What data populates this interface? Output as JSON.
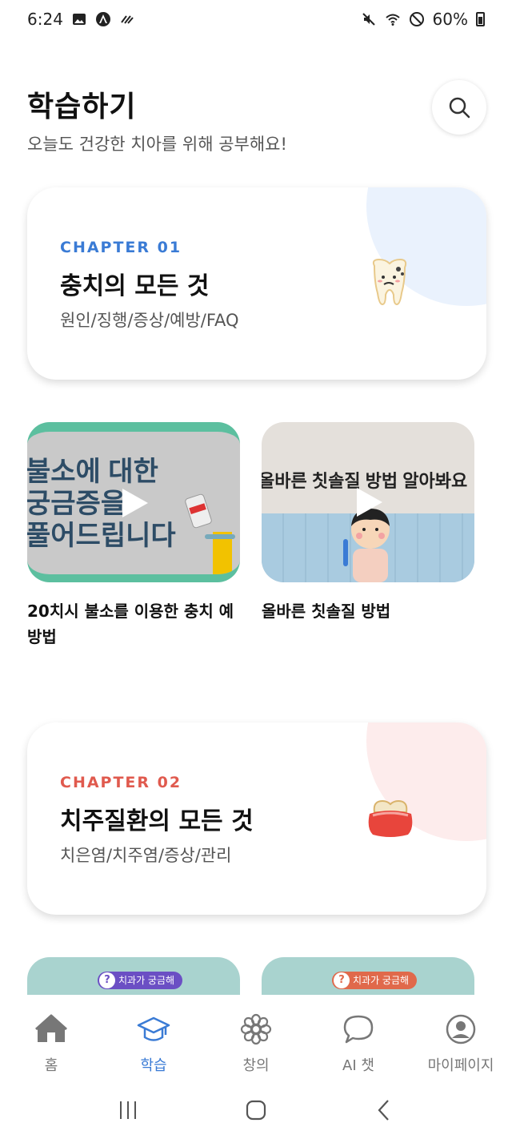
{
  "status_bar": {
    "time": "6:24",
    "battery": "60%"
  },
  "header": {
    "title": "학습하기",
    "subtitle": "오늘도 건강한 치아를 위해 공부해요!",
    "search_icon": "search-icon"
  },
  "chapters": [
    {
      "label": "CHAPTER 01",
      "title": "충치의 모든 것",
      "desc": "원인/징행/증상/예방/FAQ",
      "accent": "#3a7bd5",
      "blob": "#eaf2fd",
      "illustration": "sad-tooth-icon",
      "videos": [
        {
          "title": "20치시 불소를 이용한 충치 예방법",
          "thumb_lines": [
            "불소에 대한",
            "궁금증을",
            "풀어드립니다"
          ],
          "thumb_bg": "#c9c9c9",
          "thumb_border": "#5cbf9f"
        },
        {
          "title": "올바른 칫솔질 방법",
          "thumb_lines": [
            "올바른 칫솔질 방법 알아봐요"
          ],
          "thumb_bg": "#e4e0db",
          "thumb_border": "#9ed0e8"
        }
      ]
    },
    {
      "label": "CHAPTER 02",
      "title": "치주질환의 모든 것",
      "desc": "치은염/치주염/증상/관리",
      "accent": "#e05a4e",
      "blob": "#fdecec",
      "illustration": "gum-tooth-icon",
      "videos": [
        {
          "thumb_caption": "치과가 궁금해"
        },
        {
          "thumb_caption": "치과가 궁금해"
        }
      ]
    }
  ],
  "tabs": [
    {
      "label": "홈",
      "icon": "home-icon",
      "active": false
    },
    {
      "label": "학습",
      "icon": "graduation-cap-icon",
      "active": true
    },
    {
      "label": "창의",
      "icon": "flower-icon",
      "active": false
    },
    {
      "label": "AI 챗",
      "icon": "chat-bubble-icon",
      "active": false
    },
    {
      "label": "마이페이지",
      "icon": "profile-icon",
      "active": false
    }
  ],
  "colors": {
    "active_tab": "#3a7bd5",
    "inactive_tab": "#777777"
  }
}
